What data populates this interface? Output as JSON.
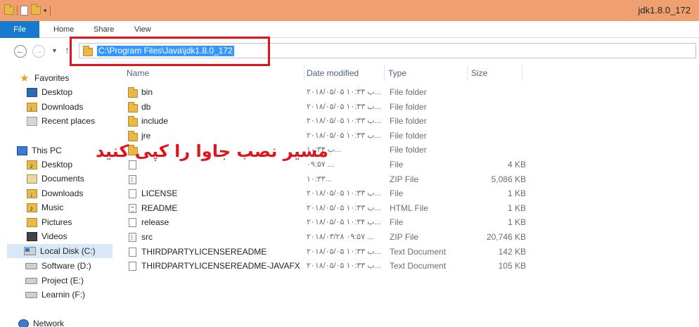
{
  "window": {
    "title": "jdk1.8.0_172"
  },
  "ribbon": {
    "tabs": [
      "File",
      "Home",
      "Share",
      "View"
    ]
  },
  "address": {
    "path": "C:\\Program Files\\Java\\jdk1.8.0_172"
  },
  "sidebar": {
    "favorites": {
      "label": "Favorites",
      "items": [
        "Desktop",
        "Downloads",
        "Recent places"
      ]
    },
    "this_pc": {
      "label": "This PC",
      "items": [
        "Desktop",
        "Documents",
        "Downloads",
        "Music",
        "Pictures",
        "Videos",
        "Local Disk (C:)",
        "Software (D:)",
        "Project (E:)",
        "Learnin (F:)"
      ]
    },
    "network": {
      "label": "Network"
    },
    "selected": "Local Disk (C:)"
  },
  "columns": {
    "name": "Name",
    "date": "Date modified",
    "type": "Type",
    "size": "Size"
  },
  "files": [
    {
      "name": "bin",
      "date": "۲۰۱۸/۰۵/۰۵ ب ۱۰:۳۳...",
      "type": "File folder",
      "size": "",
      "icon": "folder-icon"
    },
    {
      "name": "db",
      "date": "۲۰۱۸/۰۵/۰۵ ب ۱۰:۳۳...",
      "type": "File folder",
      "size": "",
      "icon": "folder-icon"
    },
    {
      "name": "include",
      "date": "۲۰۱۸/۰۵/۰۵ ب ۱۰:۳۳...",
      "type": "File folder",
      "size": "",
      "icon": "folder-icon"
    },
    {
      "name": "jre",
      "date": "۲۰۱۸/۰۵/۰۵ ب ۱۰:۳۳...",
      "type": "File folder",
      "size": "",
      "icon": "folder-icon"
    },
    {
      "name": "",
      "date": "ب ۱۰:۳۴...",
      "type": "File folder",
      "size": "",
      "icon": "folder-icon"
    },
    {
      "name": "",
      "date": "۰۹:۵۷ ...",
      "type": "File",
      "size": "4 KB",
      "icon": "file-icon"
    },
    {
      "name": "",
      "date": "۱۰:۳۳...",
      "type": "ZIP File",
      "size": "5,086 KB",
      "icon": "zip-icon"
    },
    {
      "name": "LICENSE",
      "date": "۲۰۱۸/۰۵/۰۵ ب ۱۰:۳۳...",
      "type": "File",
      "size": "1 KB",
      "icon": "file-icon"
    },
    {
      "name": "README",
      "date": "۲۰۱۸/۰۵/۰۵ ب ۱۰:۳۳...",
      "type": "HTML File",
      "size": "1 KB",
      "icon": "html-file-icon"
    },
    {
      "name": "release",
      "date": "۲۰۱۸/۰۵/۰۵ ب ۱۰:۳۴...",
      "type": "File",
      "size": "1 KB",
      "icon": "file-icon"
    },
    {
      "name": "src",
      "date": "۲۰۱۸/۰۳/۲۸ ۰۹:۵۷ ...",
      "type": "ZIP File",
      "size": "20,746 KB",
      "icon": "zip-icon"
    },
    {
      "name": "THIRDPARTYLICENSEREADME",
      "date": "۲۰۱۸/۰۵/۰۵ ب ۱۰:۳۳...",
      "type": "Text Document",
      "size": "142 KB",
      "icon": "text-file-icon"
    },
    {
      "name": "THIRDPARTYLICENSEREADME-JAVAFX",
      "date": "۲۰۱۸/۰۵/۰۵ ب ۱۰:۳۳...",
      "type": "Text Document",
      "size": "105 KB",
      "icon": "text-file-icon"
    }
  ],
  "annotation": {
    "text": "مسیر نصب جاوا را کپی کنید",
    "color": "#e0151b"
  },
  "colors": {
    "title_bar": "#f0a070",
    "file_tab": "#1979ca",
    "selection": "#3399ff",
    "highlight_box": "#e0151b"
  }
}
